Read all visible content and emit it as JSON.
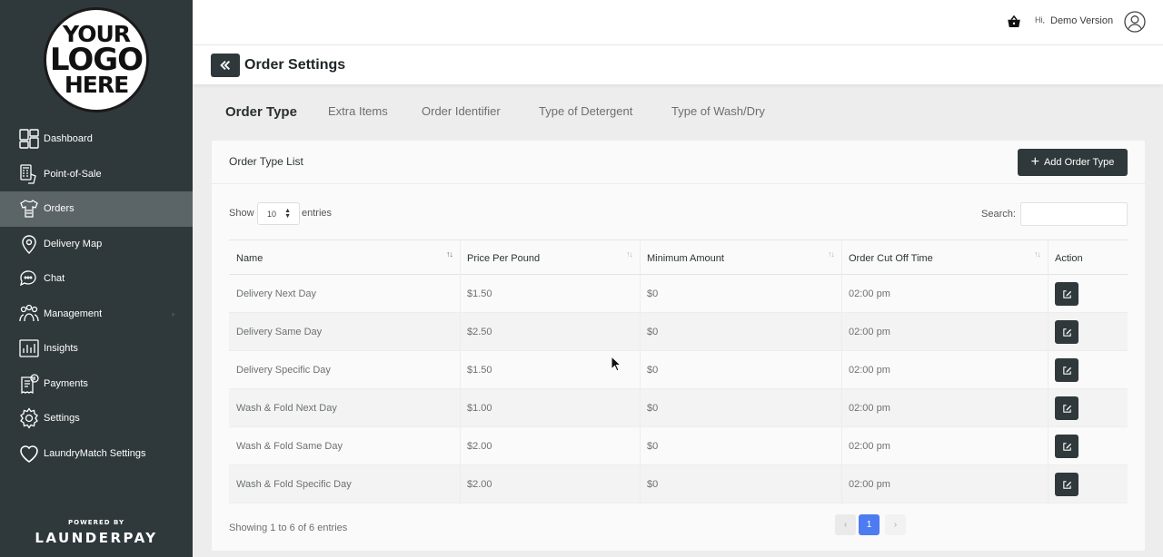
{
  "logo": {
    "line1": "YOUR",
    "line2": "LOGO",
    "line3": "HERE"
  },
  "sidebar": {
    "items": [
      {
        "label": "Dashboard",
        "icon": "dashboard-icon"
      },
      {
        "label": "Point-of-Sale",
        "icon": "point-of-sale-icon"
      },
      {
        "label": "Orders",
        "icon": "orders-icon",
        "active": true
      },
      {
        "label": "Delivery Map",
        "icon": "map-pin-icon"
      },
      {
        "label": "Chat",
        "icon": "chat-icon"
      },
      {
        "label": "Management",
        "icon": "management-icon",
        "chevron": "›"
      },
      {
        "label": "Insights",
        "icon": "insights-icon"
      },
      {
        "label": "Payments",
        "icon": "payments-icon"
      },
      {
        "label": "Settings",
        "icon": "gear-icon"
      },
      {
        "label": "LaundryMatch Settings",
        "icon": "heart-icon"
      }
    ],
    "powered_by": "POWERED BY",
    "brand": "LAUNDERPAY"
  },
  "topbar": {
    "greeting": "Hi,",
    "user": "Demo Version"
  },
  "page": {
    "title": "Order Settings"
  },
  "tabs": [
    {
      "label": "Order Type",
      "active": true
    },
    {
      "label": "Extra Items"
    },
    {
      "label": "Order Identifier"
    },
    {
      "label": "Type of Detergent"
    },
    {
      "label": "Type of Wash/Dry"
    }
  ],
  "card": {
    "title": "Order Type List",
    "add_button": "Add Order Type",
    "show_label": "Show",
    "page_length": "10",
    "entries_label": "entries",
    "search_label": "Search:"
  },
  "table": {
    "columns": [
      "Name",
      "Price Per Pound",
      "Minimum Amount",
      "Order Cut Off Time",
      "Action"
    ],
    "rows": [
      [
        "Delivery Next Day",
        "$1.50",
        "$0",
        "02:00 pm"
      ],
      [
        "Delivery Same Day",
        "$2.50",
        "$0",
        "02:00 pm"
      ],
      [
        "Delivery Specific Day",
        "$1.50",
        "$0",
        "02:00 pm"
      ],
      [
        "Wash & Fold Next Day",
        "$1.00",
        "$0",
        "02:00 pm"
      ],
      [
        "Wash & Fold Same Day",
        "$2.00",
        "$0",
        "02:00 pm"
      ],
      [
        "Wash & Fold Specific Day",
        "$2.00",
        "$0",
        "02:00 pm"
      ]
    ]
  },
  "footer": {
    "info": "Showing 1 to 6 of 6 entries",
    "prev": "‹",
    "current_page": "1",
    "next": "›"
  },
  "colors": {
    "sidebar": "#2f393b",
    "active_item": "#5b6466",
    "accent": "#4d7cf0"
  }
}
